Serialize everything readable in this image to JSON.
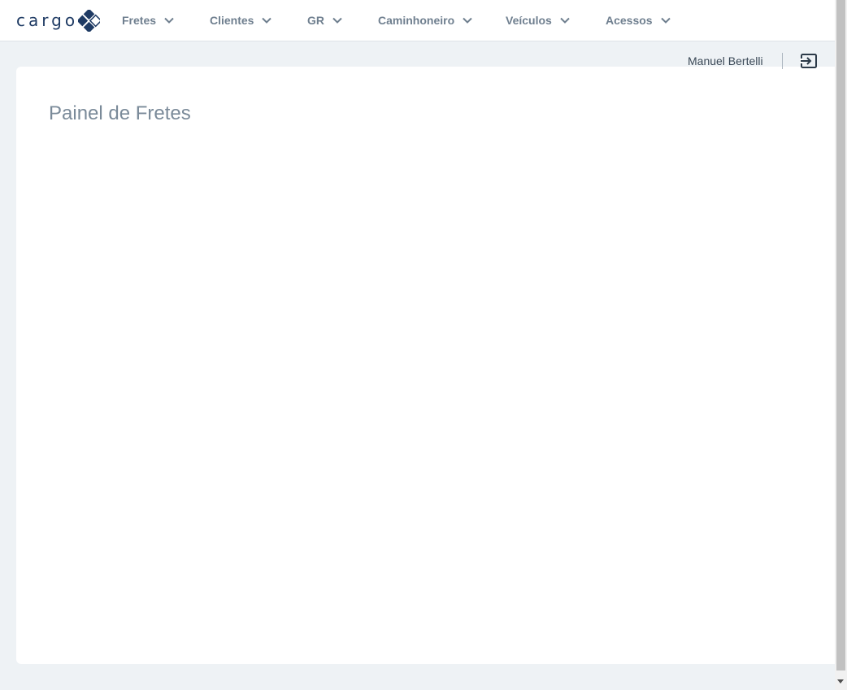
{
  "header": {
    "logo_text": "cargo",
    "nav": [
      {
        "label": "Fretes"
      },
      {
        "label": "Clientes"
      },
      {
        "label": "GR"
      },
      {
        "label": "Caminhoneiro"
      },
      {
        "label": "Veículos"
      },
      {
        "label": "Acessos"
      }
    ]
  },
  "user": {
    "name": "Manuel Bertelli"
  },
  "main": {
    "title": "Painel de Fretes"
  },
  "colors": {
    "brand": "#1f3b64",
    "nav_text": "#6f7f8f",
    "background": "#eef2f5"
  }
}
